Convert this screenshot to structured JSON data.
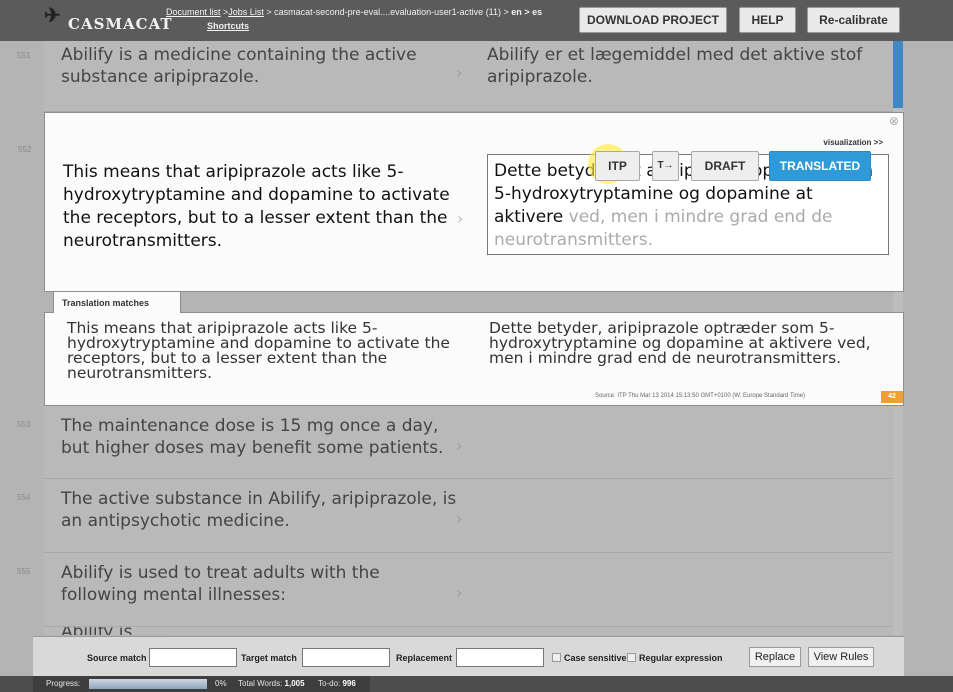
{
  "header": {
    "logo_text": "CASMACAT",
    "breadcrumb": {
      "document_list": "Document list",
      "sep1": " >",
      "jobs_list": "Jobs List",
      "path": " > casmacat-second-pre-eval....evaluation-user1-active",
      "count": " (11) > ",
      "src_lang": "en",
      "arrow": " > ",
      "tgt_lang": "es",
      "shortcuts": "Shortcuts"
    },
    "buttons": {
      "download": "DOWNLOAD PROJECT",
      "help": "HELP",
      "recalibrate": "Re-calibrate"
    }
  },
  "segments": [
    {
      "id": "551",
      "source": "Abilify is a medicine containing the active substance aripiprazole.",
      "target": "Abilify er et lægemiddel med det aktive stof aripiprazole.",
      "arrow": "›"
    },
    {
      "id": "553",
      "source": "The maintenance dose is 15 mg once a day, but higher doses may benefit some patients.",
      "target": "",
      "arrow": "›"
    },
    {
      "id": "554",
      "source": "The active substance in Abilify, aripiprazole, is an antipsychotic medicine.",
      "target": "",
      "arrow": "›"
    },
    {
      "id": "555",
      "source": "Abilify is used to treat adults with the following mental illnesses:",
      "target": "",
      "arrow": "›"
    },
    {
      "id": "",
      "source": "Abilify is ......",
      "target": "",
      "arrow": ""
    }
  ],
  "active_segment": {
    "id": "552",
    "close_icon": "⊗",
    "visualization": "visualization >>",
    "source": "This means that aripiprazole acts like 5-hydroxytryptamine and dopamine to activate the receptors, but to a lesser extent than the neurotransmitters.",
    "arrow": "›",
    "target_typed": "Dette betyder, at aripiprazole optræder som 5-hydroxytryptamine og dopamine at aktivere",
    "target_pending": "ved, men i mindre grad end de neurotransmitters.",
    "buttons": {
      "itp": "ITP",
      "t_toggle": "T→",
      "draft": "DRAFT",
      "translated": "TRANSLATED"
    }
  },
  "matches": {
    "tab_label": "Translation matches",
    "source": "This means that aripiprazole acts like 5-hydroxytryptamine and dopamine to activate the receptors, but to a lesser extent than the neurotransmitters.",
    "target": "Dette betyder, aripiprazole optræder som 5-hydroxytryptamine og dopamine at aktivere ved, men i mindre grad end de neurotransmitters.",
    "source_info": "Source: ITP   Thu Mar 13 2014 15:13:50 GMT+0100 (W. Europe Standard Time)",
    "score": "42"
  },
  "searchbar": {
    "source_match": "Source match",
    "target_match": "Target match",
    "replacement": "Replacement",
    "case_sensitive": "Case sensitive",
    "regex": "Regular expression",
    "replace_btn": "Replace",
    "view_rules_btn": "View Rules"
  },
  "footer": {
    "progress_label": "Progress:",
    "progress_value": 0,
    "progress_pct": "0%",
    "total_words_label": "Total Words:",
    "total_words": "1,005",
    "todo_label": "To-do:",
    "todo": "996"
  },
  "colors": {
    "accent": "#2f9ad8",
    "header": "#5b5b5b",
    "score": "#f0a030"
  }
}
